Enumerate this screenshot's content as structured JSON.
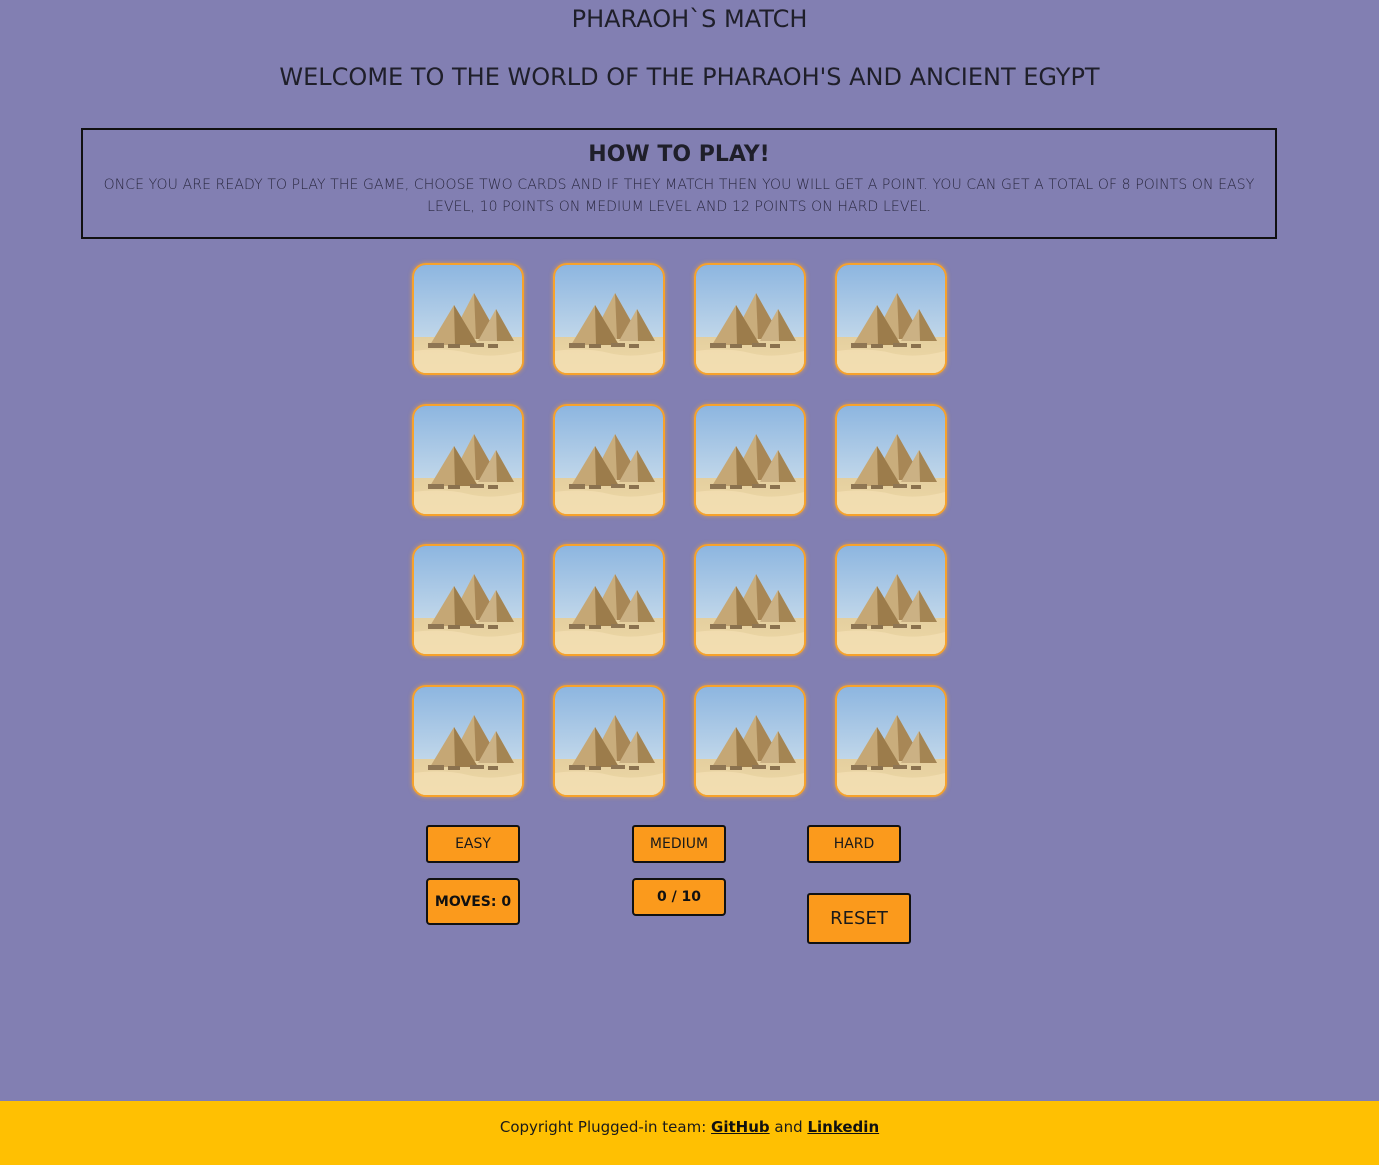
{
  "header": {
    "title": "PHARAOH`S MATCH",
    "welcome": "WELCOME TO THE WORLD OF THE PHARAOH'S AND ANCIENT EGYPT"
  },
  "instructions": {
    "heading": "HOW TO PLAY!",
    "text": "ONCE YOU ARE READY TO PLAY THE GAME, CHOOSE TWO CARDS AND IF THEY MATCH THEN YOU WILL GET A POINT. YOU CAN GET A TOTAL OF 8 POINTS ON EASY LEVEL, 10 POINTS ON MEDIUM LEVEL AND 12 POINTS ON HARD LEVEL."
  },
  "board": {
    "rows": 4,
    "cols": 4,
    "card_back": "pyramids-of-giza-image",
    "card_border_color": "#f7a22b"
  },
  "levels": {
    "easy": "EASY",
    "medium": "MEDIUM",
    "hard": "HARD"
  },
  "stats": {
    "moves": "MOVES: 0",
    "score": "0 / 10"
  },
  "controls": {
    "reset": "RESET"
  },
  "footer": {
    "text": "Copyright Plugged-in team:",
    "github": "GitHub",
    "and": "and",
    "linkedin": "Linkedin"
  },
  "colors": {
    "background": "#827fb2",
    "button": "#fb9a1c",
    "footer": "#ffc002"
  }
}
